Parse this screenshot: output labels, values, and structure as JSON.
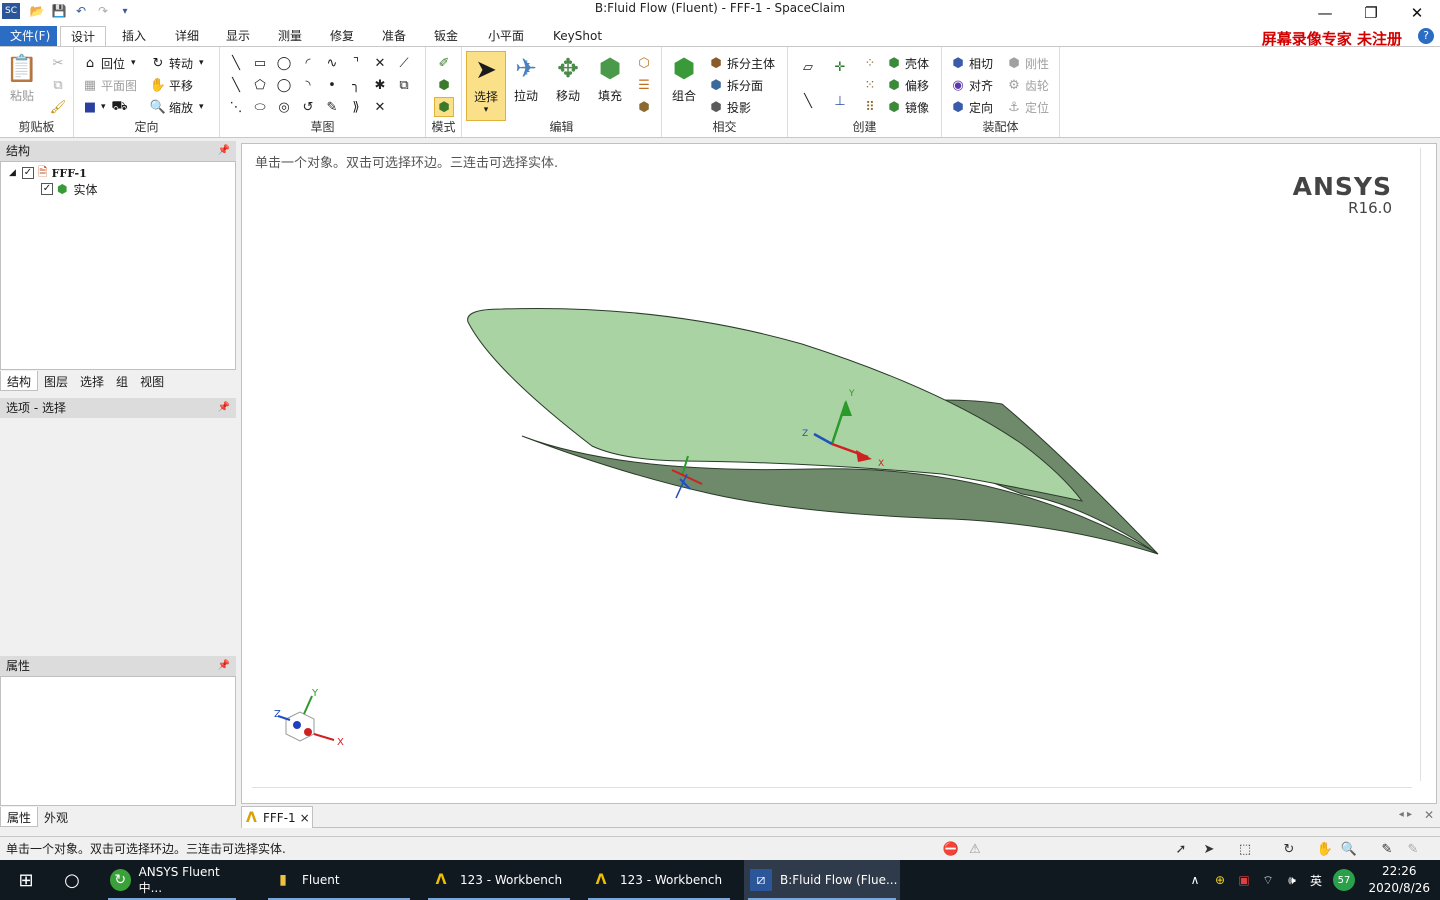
{
  "window": {
    "title": "B:Fluid Flow (Fluent) - FFF-1 - SpaceClaim",
    "logo_text": "SC"
  },
  "ribbon_tabs": [
    "文件(F)",
    "设计",
    "插入",
    "详细",
    "显示",
    "测量",
    "修复",
    "准备",
    "钣金",
    "小平面",
    "KeyShot"
  ],
  "watermark": "屏幕录像专家  未注册",
  "help": "?",
  "groups": {
    "clipboard": {
      "label": "剪贴板",
      "paste": "粘贴"
    },
    "orient": {
      "label": "定向",
      "home": "回位",
      "spin": "转动",
      "plan_view": "平面图",
      "pan": "平移",
      "zoom": "缩放"
    },
    "sketch": {
      "label": "草图"
    },
    "mode": {
      "label": "模式"
    },
    "edit": {
      "label": "编辑",
      "select": "选择",
      "pull": "拉动",
      "move": "移动",
      "fill": "填充"
    },
    "intersect": {
      "label": "相交",
      "combine": "组合",
      "split_body": "拆分主体",
      "split_face": "拆分面",
      "project": "投影"
    },
    "create": {
      "label": "创建",
      "shell": "壳体",
      "offset": "偏移",
      "mirror": "镜像"
    },
    "assembly": {
      "label": "装配体",
      "tangent": "相切",
      "rigid": "刚性",
      "align": "对齐",
      "gear": "齿轮",
      "orient": "定向",
      "anchor": "定位"
    }
  },
  "structure_panel": {
    "title": "结构",
    "pin": "ᵖ",
    "root": "FFF-1",
    "child": "实体",
    "tabs": [
      "结构",
      "图层",
      "选择",
      "组",
      "视图"
    ]
  },
  "options_panel": {
    "title": "选项 - 选择"
  },
  "properties_panel": {
    "title": "属性",
    "tabs": [
      "属性",
      "外观"
    ]
  },
  "viewport": {
    "hint": "单击一个对象。双击可选择环边。三连击可选择实体.",
    "brand": "ANSYS",
    "version": "R16.0",
    "axis_x": "X",
    "axis_y": "Y",
    "axis_z": "Z"
  },
  "doc_tab": {
    "label": "FFF-1",
    "close": "×",
    "logo": "Λ"
  },
  "status_bar": {
    "text": "单击一个对象。双击可选择环边。三连击可选择实体."
  },
  "taskbar": {
    "items": [
      "ANSYS Fluent 中...",
      "Fluent",
      "123 - Workbench",
      "123 - Workbench",
      "B:Fluid Flow (Flue..."
    ],
    "ime": "英",
    "badge": "57",
    "time": "22:26",
    "date": "2020/8/26"
  },
  "colors": {
    "accent": "#2b6cc4",
    "body_top": "#a9d3a3",
    "body_side": "#6f8a6a",
    "watermark": "#d40000",
    "taskbar": "#101820"
  }
}
